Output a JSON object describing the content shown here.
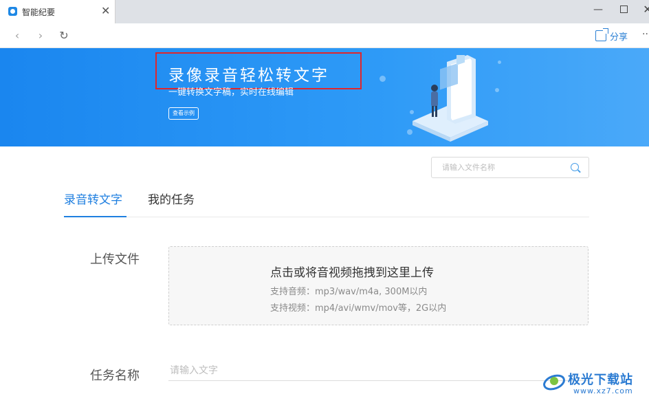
{
  "window": {
    "tab_title": "智能纪要",
    "close_glyph": "✕",
    "min_glyph": "—",
    "close_window_glyph": "✕"
  },
  "nav": {
    "back_glyph": "‹",
    "forward_glyph": "›",
    "reload_glyph": "↻",
    "share_label": "分享",
    "more_glyph": "··"
  },
  "banner": {
    "title": "录像录音轻松转文字",
    "subtitle": "一键转换文字稿，实时在线编辑",
    "button_label": "查看示例"
  },
  "search": {
    "placeholder": "请输入文件名称"
  },
  "tabs": [
    {
      "label": "录音转文字",
      "active": true
    },
    {
      "label": "我的任务",
      "active": false
    }
  ],
  "upload": {
    "label": "上传文件",
    "main_text": "点击或将音视频拖拽到这里上传",
    "audio_formats": "支持音频：mp3/wav/m4a, 300M以内",
    "video_formats": "支持视频：mp4/avi/wmv/mov等，2G以内"
  },
  "task": {
    "label": "任务名称",
    "placeholder": "请输入文字"
  },
  "watermark": {
    "text": "极光下载站",
    "url": "www.xz7.com"
  },
  "colors": {
    "accent": "#1f7fe0",
    "banner": "#2f9bf7",
    "highlight": "#e0262b"
  }
}
